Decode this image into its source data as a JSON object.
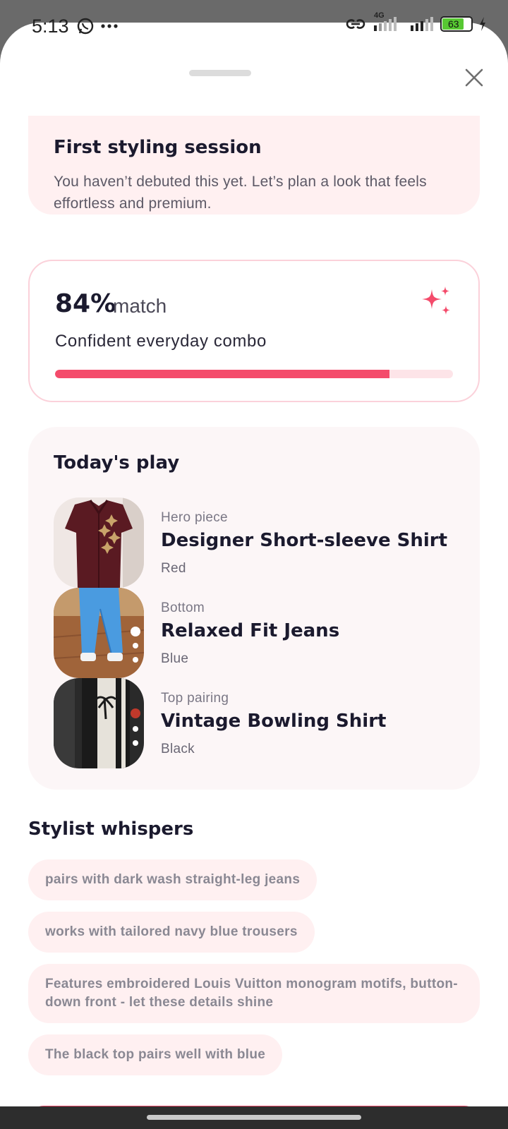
{
  "status_bar": {
    "time": "5:13",
    "network": "4G",
    "battery": "63",
    "icons": [
      "whatsapp-icon",
      "more-dots-icon",
      "link-icon",
      "signal-icon",
      "signal-icon",
      "battery-icon",
      "charging-icon"
    ]
  },
  "sheet": {
    "close_icon": "close-icon"
  },
  "session": {
    "title": "First styling session",
    "text": "You haven’t debuted this yet. Let’s plan a look that feels effortless and premium."
  },
  "match": {
    "percent": "84%",
    "word": "match",
    "subtitle": "Confident everyday combo",
    "progress": 0.84,
    "icon": "sparkles-icon"
  },
  "play": {
    "title": "Today's play",
    "items": [
      {
        "role": "Hero piece",
        "name": "Designer Short-sleeve Shirt",
        "color": "Red"
      },
      {
        "role": "Bottom",
        "name": "Relaxed Fit Jeans",
        "color": "Blue"
      },
      {
        "role": "Top pairing",
        "name": "Vintage Bowling Shirt",
        "color": "Black"
      }
    ]
  },
  "whispers": {
    "title": "Stylist whispers",
    "chips": [
      "pairs with dark wash straight-leg jeans",
      "works with tailored navy blue trousers",
      "Features embroidered Louis Vuitton monogram motifs, button-down front - let these details shine",
      "The black top pairs well with blue"
    ]
  },
  "colors": {
    "accent": "#f44b6b",
    "card_pink": "#fff0f1",
    "text_dark": "#1b1a2e"
  }
}
